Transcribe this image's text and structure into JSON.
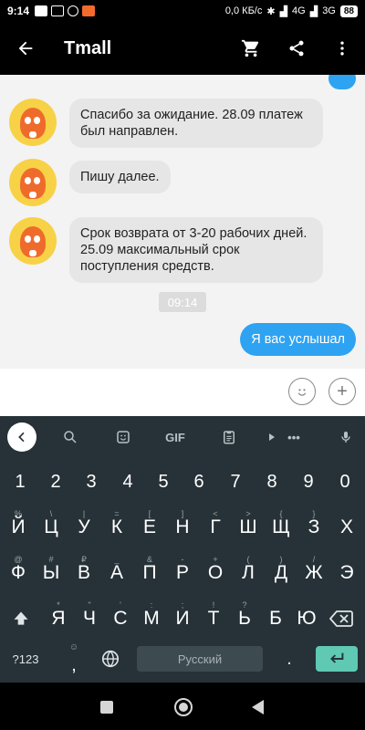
{
  "status_bar": {
    "time": "9:14",
    "network_speed": "0,0 КБ/с",
    "network_4g": "4G",
    "network_3g": "3G",
    "battery": "88"
  },
  "header": {
    "title": "Tmall"
  },
  "chat": {
    "messages": [
      {
        "text": "Спасибо за ожидание. 28.09 платеж был направлен."
      },
      {
        "text": "Пишу далее."
      },
      {
        "text": "Срок возврата от 3-20 рабочих дней. 25.09 максимальный срок поступления средств."
      }
    ],
    "timestamp": "09:14",
    "sent_message": "Я вас услышал"
  },
  "keyboard": {
    "toolbar_gif": "GIF",
    "toolbar_more": "•••",
    "number_row": [
      "1",
      "2",
      "3",
      "4",
      "5",
      "6",
      "7",
      "8",
      "9",
      "0"
    ],
    "row1": [
      "Й",
      "Ц",
      "У",
      "К",
      "Е",
      "Н",
      "Г",
      "Ш",
      "Щ",
      "З",
      "Х"
    ],
    "row1_hints": [
      "%",
      "\\",
      "|",
      "=",
      "[",
      "]",
      "<",
      ">",
      "{",
      "}",
      ""
    ],
    "row2": [
      "Ф",
      "Ы",
      "В",
      "А",
      "П",
      "Р",
      "О",
      "Л",
      "Д",
      "Ж",
      "Э"
    ],
    "row2_hints": [
      "@",
      "#",
      "₽",
      "_",
      "&",
      "-",
      "+",
      "(",
      ")",
      "/",
      ""
    ],
    "row3": [
      "Я",
      "Ч",
      "С",
      "М",
      "И",
      "Т",
      "Ь",
      "Б",
      "Ю"
    ],
    "row3_hints": [
      "*",
      "\"",
      "'",
      ":",
      ";",
      "!",
      "?",
      "",
      ""
    ],
    "symbols_label": "?123",
    "comma_hint": "☺",
    "space_label": "Русский"
  }
}
